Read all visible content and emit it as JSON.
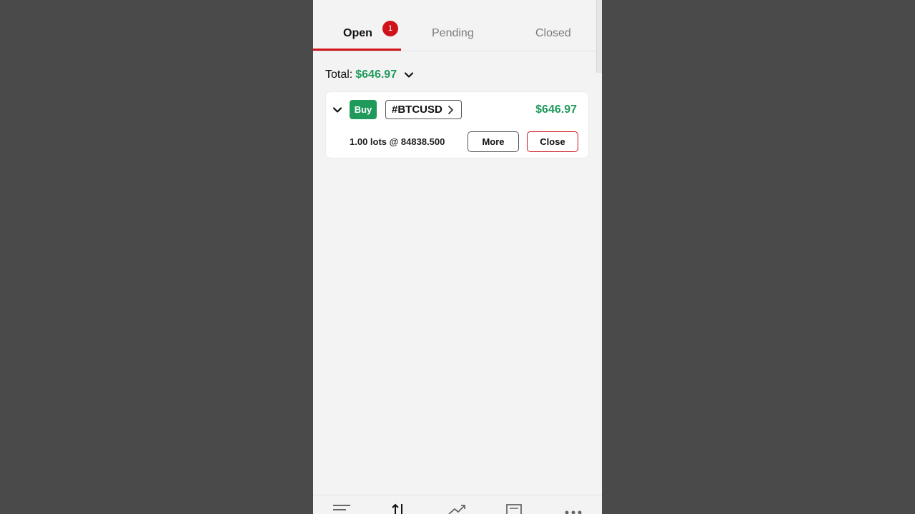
{
  "tabs": {
    "open": "Open",
    "open_badge": "1",
    "pending": "Pending",
    "closed": "Closed"
  },
  "summary": {
    "total_label": "Total:",
    "total_amount": "$646.97"
  },
  "position": {
    "side": "Buy",
    "symbol": "#BTCUSD",
    "pnl": "$646.97",
    "lots_text": "1.00 lots @ 84838.500",
    "more_label": "More",
    "close_label": "Close"
  },
  "bottom_nav": {
    "icons": [
      "list-icon",
      "trade-arrows-icon",
      "chart-trend-icon",
      "news-icon",
      "more-dots-icon"
    ]
  },
  "colors": {
    "accent_red": "#d0121b",
    "profit_green": "#1f9a5a",
    "background": "#f3f3f3",
    "outer": "#4a4a4a"
  }
}
